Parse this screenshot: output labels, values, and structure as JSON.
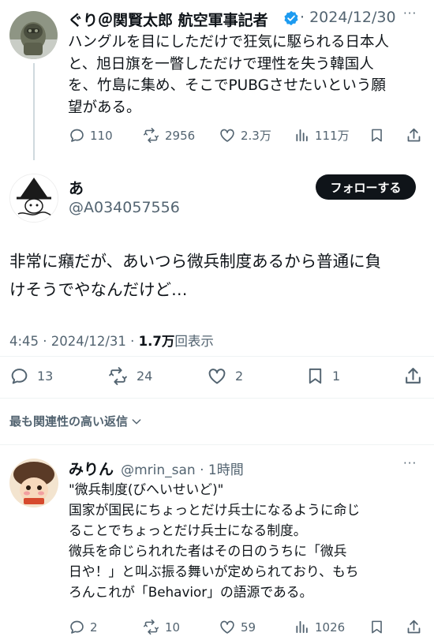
{
  "tweet1": {
    "name": "ぐり＠関賢太郎 航空軍事記者",
    "date": "· 2024/12/30",
    "text_lines": [
      "ハングルを目にしただけで狂気に駆られる日本人",
      "と、旭日旗を一瞥しただけで理性を失う韓国人",
      "を、竹島に集め、そこでPUBGさせたいという願",
      "望がある。"
    ],
    "replies": "110",
    "reposts": "2956",
    "likes": "2.3万",
    "views": "111万"
  },
  "tweet2": {
    "name": "あ",
    "handle": "@A034057556",
    "follow_label": "フォローする",
    "text_lines": [
      "非常に癪だが、あいつら微兵制度あるから普通に負",
      "けそうでやなんだけど…"
    ],
    "time": "4:45 · 2024/12/31 · ",
    "view_count": "1.7万",
    "view_suffix": "回表示",
    "replies": "13",
    "reposts": "24",
    "likes": "2",
    "bookmarks": "1"
  },
  "sort_label": "最も関連性の高い返信",
  "reply": {
    "name": "みりん",
    "handle": "@mrin_san · 1時間",
    "text_lines": [
      "\"微兵制度(びへいせいど)\"",
      "国家が国民にちょっとだけ兵士になるように命じ",
      "ることでちょっとだけ兵士になる制度。",
      "微兵を命じられれた者はその日のうちに「微兵",
      "日や！」と叫ぶ振る舞いが定められており、もち",
      "ろんこれが「Behavior」の語源である。"
    ],
    "replies": "2",
    "reposts": "10",
    "likes": "59",
    "views": "1026"
  },
  "more_label": "···",
  "colors": {
    "verified": "#1d9bf0",
    "text": "#0f1419",
    "muted": "#536471"
  }
}
